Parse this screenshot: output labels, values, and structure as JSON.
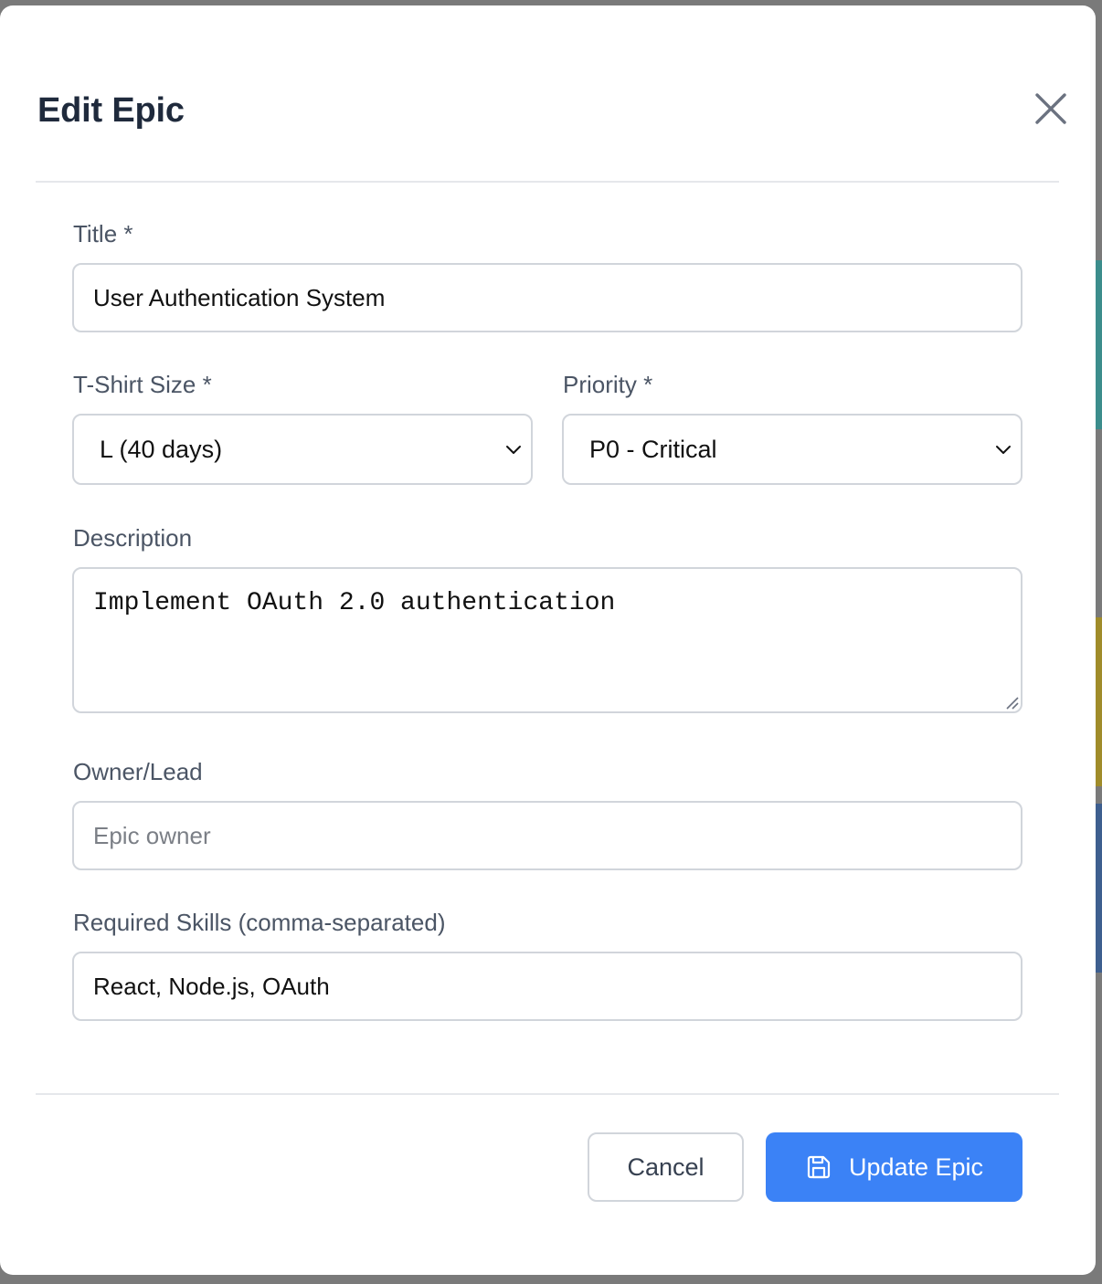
{
  "modal": {
    "title": "Edit Epic"
  },
  "form": {
    "title_label": "Title *",
    "title_value": "User Authentication System",
    "size_label": "T-Shirt Size *",
    "size_value": "L (40 days)",
    "priority_label": "Priority *",
    "priority_value": "P0 - Critical",
    "description_label": "Description",
    "description_value": "Implement OAuth 2.0 authentication",
    "owner_label": "Owner/Lead",
    "owner_value": "",
    "owner_placeholder": "Epic owner",
    "skills_label": "Required Skills (comma-separated)",
    "skills_value": "React, Node.js, OAuth"
  },
  "footer": {
    "cancel_label": "Cancel",
    "submit_label": "Update Epic"
  },
  "icons": {
    "close": "close-icon",
    "chevron": "chevron-down-icon",
    "save": "save-icon",
    "resize": "resize-handle-icon"
  },
  "colors": {
    "primary": "#3b82f6",
    "backdrop": "#7a7a7a",
    "title_text": "#1f2a3c",
    "label_text": "#4b5565",
    "border": "#d1d5db",
    "divider": "#e5e7eb"
  }
}
